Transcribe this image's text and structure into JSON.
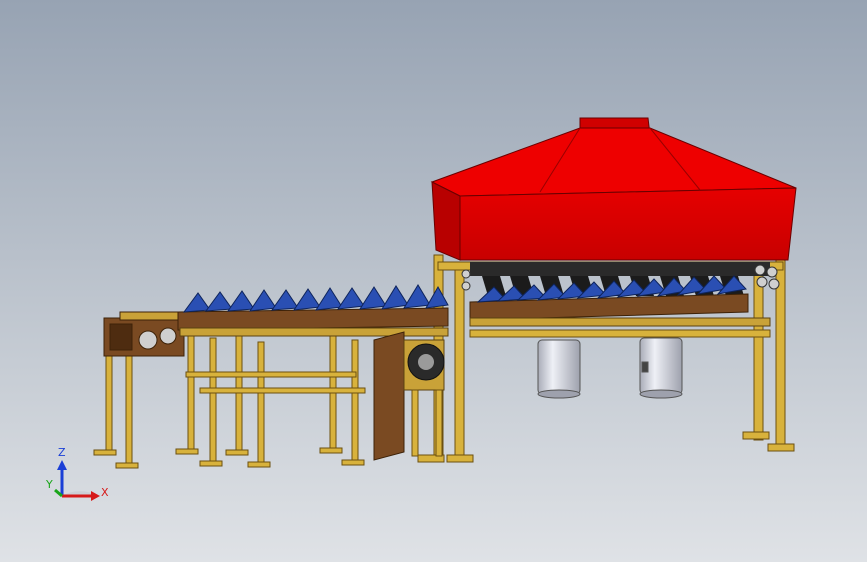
{
  "viewport": {
    "background_top": "#97a3b3",
    "background_bottom": "#dfe2e6"
  },
  "colors": {
    "hood": "#e80000",
    "hood_shadow": "#b30000",
    "frame": "#d8b23c",
    "frame_dark": "#8c6a14",
    "wood": "#7a4a22",
    "wood_dark": "#4e2c10",
    "molds": "#2a4fb3",
    "cylinders": "#d9dbe4"
  },
  "triad": {
    "z_label": "Z",
    "y_label": "Y",
    "x_label": "X",
    "z_color": "#1a3fd6",
    "y_color": "#1aa51a",
    "x_color": "#d61a1a"
  },
  "icons": {
    "triad": "xyz-axis-triad-icon"
  }
}
